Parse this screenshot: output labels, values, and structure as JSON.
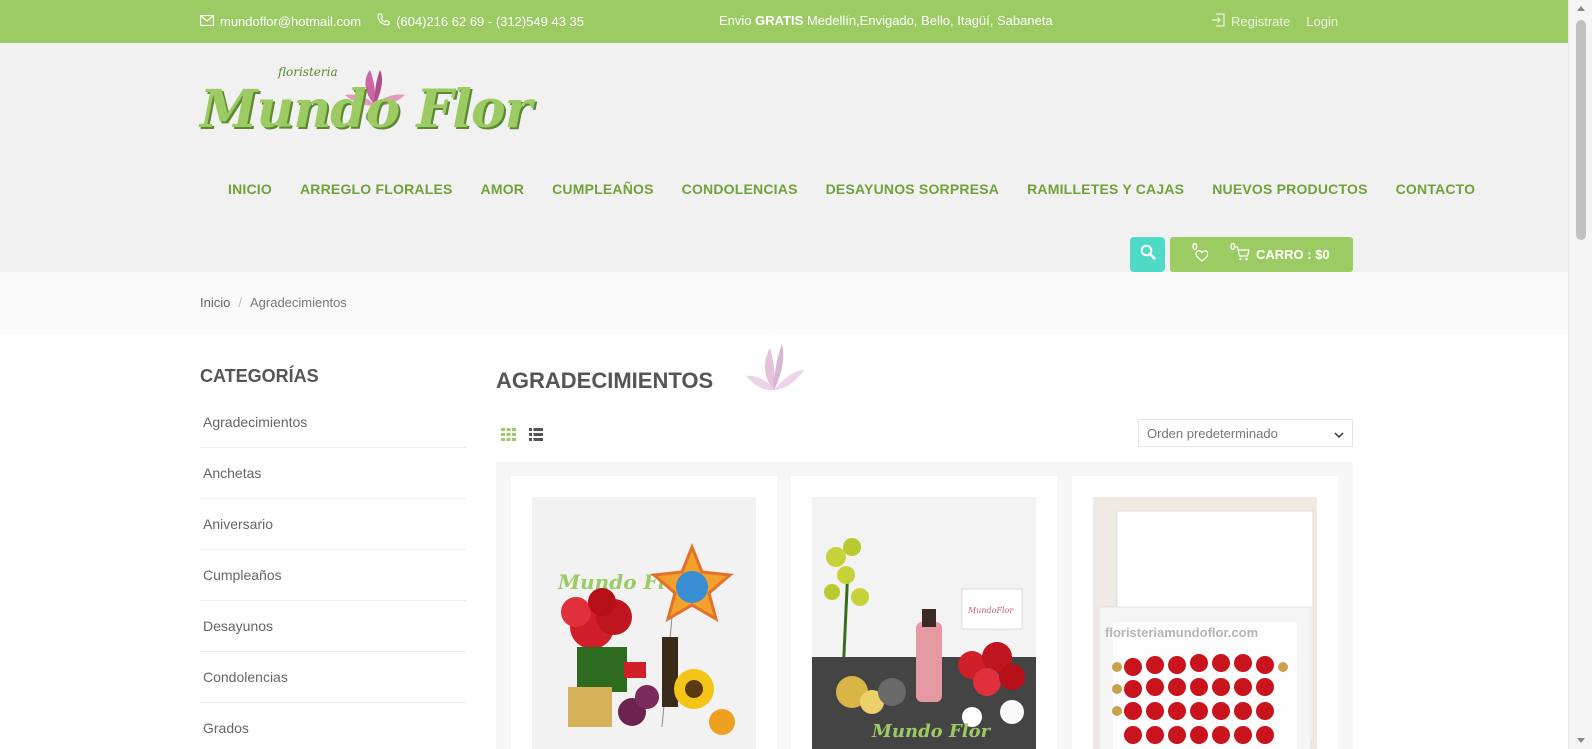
{
  "topbar": {
    "email": "mundoflor@hotmail.com",
    "phones": "(604)216 62 69 - (312)549 43 35",
    "shipping_prefix": "Envio",
    "shipping_bold": "GRATIS",
    "shipping_rest": "Medellín,Envigado, Bello, Itagüí, Sabaneta",
    "register": "Registrate",
    "login": "Login"
  },
  "logo": {
    "sub": "floristeria",
    "main": "Mundo Flor"
  },
  "nav": {
    "items": [
      "INICIO",
      "ARREGLO FLORALES",
      "AMOR",
      "CUMPLEAÑOS",
      "CONDOLENCIAS",
      "DESAYUNOS SORPRESA",
      "RAMILLETES Y CAJAS",
      "NUEVOS PRODUCTOS",
      "CONTACTO"
    ]
  },
  "cart": {
    "wishlist_count": "0",
    "cart_count": "0",
    "label": "CARRO : $0"
  },
  "breadcrumb": {
    "home": "Inicio",
    "separator": "/",
    "current": "Agradecimientos"
  },
  "sidebar": {
    "title": "CATEGORÍAS",
    "items": [
      "Agradecimientos",
      "Anchetas",
      "Aniversario",
      "Cumpleaños",
      "Desayunos",
      "Condolencias",
      "Grados"
    ]
  },
  "main": {
    "title": "AGRADECIMIENTOS",
    "orderby": "Orden predeterminado"
  },
  "products": [
    {
      "image": "arrangement-roses-balloon-sunflower"
    },
    {
      "image": "arrangement-orchid-champagne-roses"
    },
    {
      "image": "box-of-red-roses-chocolates"
    }
  ],
  "colors": {
    "brand_green": "#9ccb64",
    "nav_green": "#6fa339",
    "search_teal": "#4fd9c7"
  }
}
